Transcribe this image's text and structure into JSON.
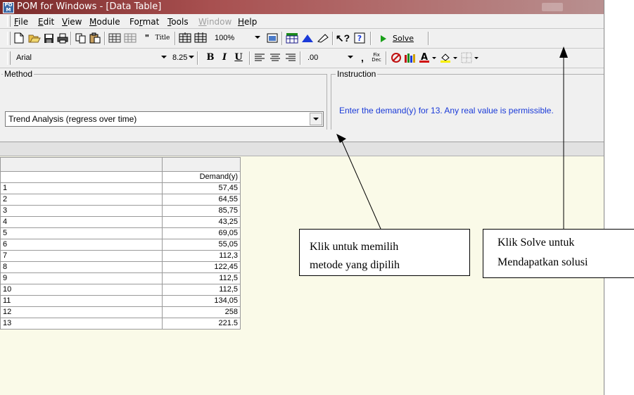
{
  "window": {
    "title": "POM for Windows - [Data Table]",
    "app_icon": "pom-app-icon"
  },
  "menu": {
    "items": [
      {
        "label": "File",
        "enabled": true
      },
      {
        "label": "Edit",
        "enabled": true
      },
      {
        "label": "View",
        "enabled": true
      },
      {
        "label": "Module",
        "enabled": true
      },
      {
        "label": "Format",
        "enabled": true
      },
      {
        "label": "Tools",
        "enabled": true
      },
      {
        "label": "Window",
        "enabled": false
      },
      {
        "label": "Help",
        "enabled": true
      }
    ]
  },
  "toolbar": {
    "zoom_value": "100%",
    "solve_label": "Solve",
    "title_tool_label": "Title"
  },
  "format_toolbar": {
    "font_name": "Arial",
    "font_size": "8.25",
    "decimal_format": ".00",
    "comma_label": ",",
    "fix_dec_label_top": "Fix",
    "fix_dec_label_bottom": "Dec"
  },
  "method": {
    "legend": "Method",
    "selected": "Trend Analysis (regress over time)"
  },
  "instruction": {
    "legend": "Instruction",
    "text": "Enter the demand(y) for  13. Any real value is permissible."
  },
  "table": {
    "column_header": "Demand(y)",
    "rows": [
      {
        "label": "1",
        "value": "57,45"
      },
      {
        "label": "2",
        "value": "64,55"
      },
      {
        "label": "3",
        "value": "85,75"
      },
      {
        "label": "4",
        "value": "43,25"
      },
      {
        "label": "5",
        "value": "69,05"
      },
      {
        "label": "6",
        "value": "55,05"
      },
      {
        "label": "7",
        "value": "112,3"
      },
      {
        "label": "8",
        "value": "122,45"
      },
      {
        "label": "9",
        "value": "112,5"
      },
      {
        "label": "10",
        "value": "112,5"
      },
      {
        "label": "11",
        "value": "134,05"
      },
      {
        "label": "12",
        "value": "258"
      },
      {
        "label": "13",
        "value": "221.5"
      }
    ]
  },
  "annotations": {
    "method_callout": {
      "line1": "Klik untuk memilih",
      "line2": "metode yang dipilih"
    },
    "solve_callout": {
      "line1": "Klik Solve untuk",
      "line2": "Mendapatkan solusi"
    }
  },
  "colors": {
    "instruction_text": "#1a3ad8",
    "titlebar": "#7a2a2a",
    "solve_play": "#1aa01a"
  }
}
